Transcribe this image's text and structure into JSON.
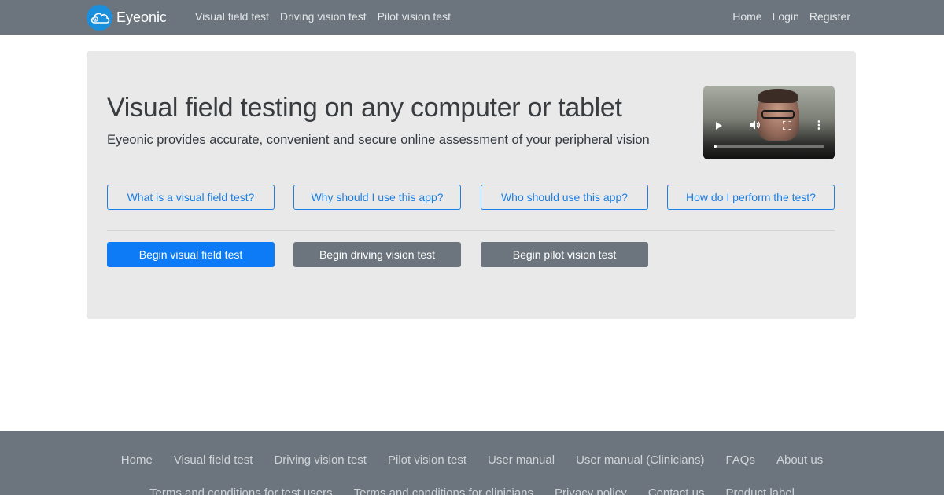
{
  "navbar": {
    "brand": "Eyeonic",
    "left_links": [
      "Visual field test",
      "Driving vision test",
      "Pilot vision test"
    ],
    "right_links": [
      "Home",
      "Login",
      "Register"
    ]
  },
  "hero": {
    "title": "Visual field testing on any computer or tablet",
    "lead": "Eyeonic provides accurate, convenient and secure online assessment of your peripheral vision"
  },
  "video": {
    "play_icon": "play-icon",
    "volume_icon": "volume-icon",
    "fullscreen_icon": "fullscreen-icon",
    "menu_icon": "more-vertical-icon",
    "progress": 0.03
  },
  "info_buttons": [
    "What is a visual field test?",
    "Why should I use this app?",
    "Who should use this app?",
    "How do I perform the test?"
  ],
  "action_buttons": {
    "primary": "Begin visual field test",
    "driving": "Begin driving vision test",
    "pilot": "Begin pilot vision test"
  },
  "footer": {
    "row1": [
      "Home",
      "Visual field test",
      "Driving vision test",
      "Pilot vision test",
      "User manual",
      "User manual (Clinicians)",
      "FAQs",
      "About us"
    ],
    "row2": [
      "Terms and conditions for test users",
      "Terms and conditions for clinicians",
      "Privacy policy",
      "Contact us",
      "Product label"
    ]
  },
  "colors": {
    "navbar": "#6c757d",
    "primary": "#0c7bf5",
    "outline": "#1a7fe6",
    "jumbotron": "#e9e9e9",
    "logo": "#1a8fdc"
  }
}
